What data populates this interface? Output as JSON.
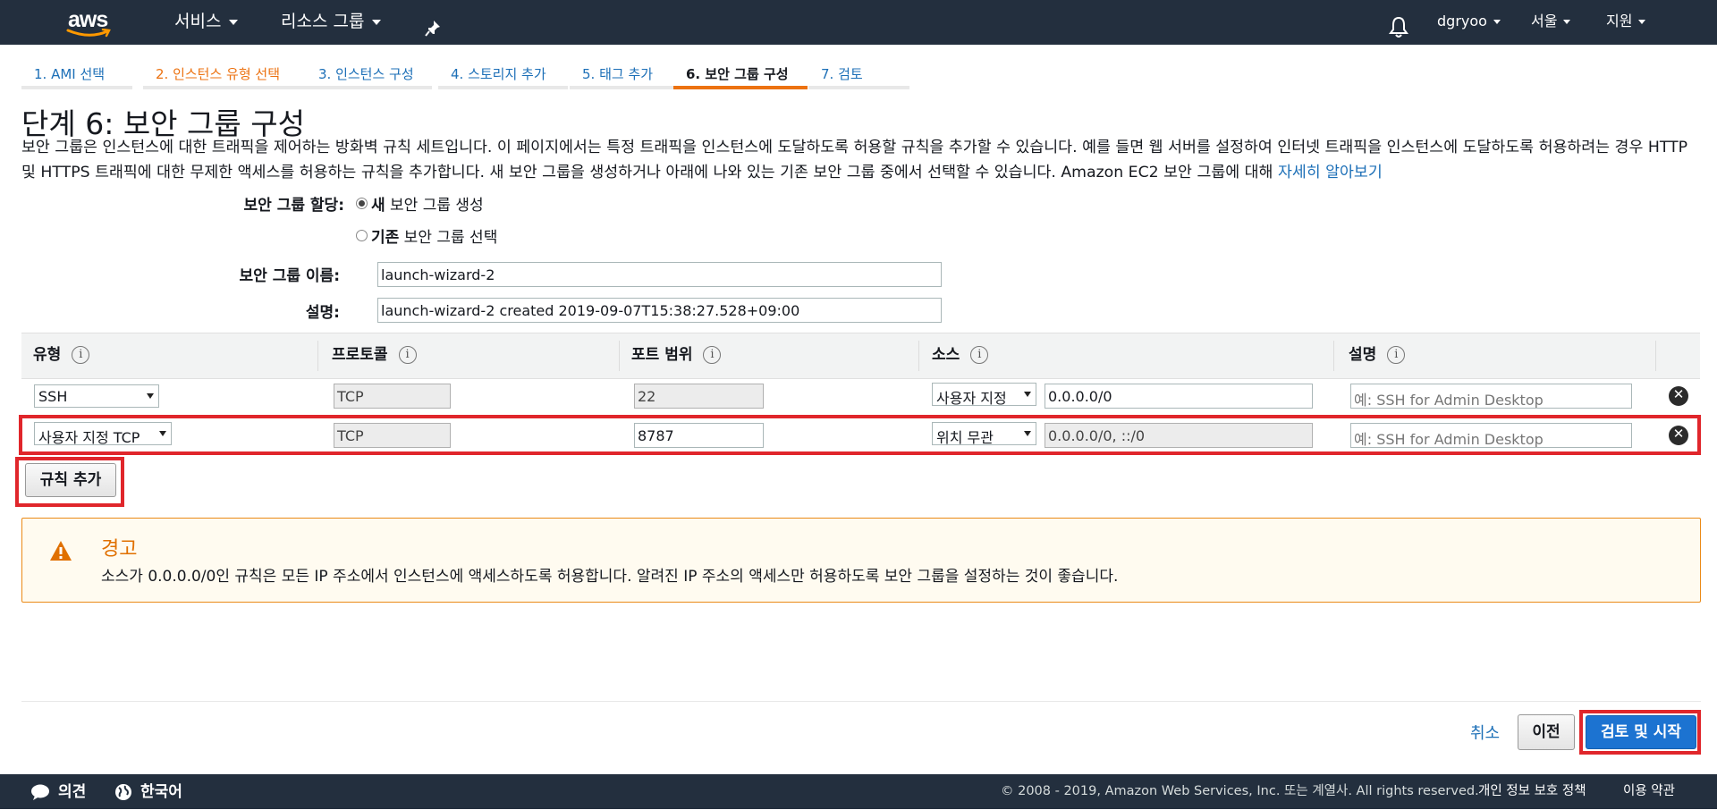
{
  "topnav": {
    "logo": "aws",
    "services": "서비스",
    "resource_groups": "리소스 그룹",
    "user": "dgryoo",
    "region": "서울",
    "support": "지원",
    "icons": [
      "pin-icon",
      "bell-icon"
    ]
  },
  "steps": [
    {
      "label": "1. AMI 선택"
    },
    {
      "label": "2. 인스턴스 유형 선택"
    },
    {
      "label": "3. 인스턴스 구성"
    },
    {
      "label": "4. 스토리지 추가"
    },
    {
      "label": "5. 태그 추가"
    },
    {
      "label": "6. 보안 그룹 구성"
    },
    {
      "label": "7. 검토"
    }
  ],
  "page": {
    "title": "단계 6: 보안 그룹 구성",
    "intro": "보안 그룹은 인스턴스에 대한 트래픽을 제어하는 방화벽 규칙 세트입니다. 이 페이지에서는 특정 트래픽을 인스턴스에 도달하도록 허용할 규칙을 추가할 수 있습니다. 예를 들면 웹 서버를 설정하여 인터넷 트래픽을 인스턴스에 도달하도록 허용하려는 경우 HTTP 및 HTTPS 트래픽에 대한 무제한 액세스를 허용하는 규칙을 추가합니다. 새 보안 그룹을 생성하거나 아래에 나와 있는 기존 보안 그룹 중에서 선택할 수 있습니다. Amazon EC2 보안 그룹에 대해 ",
    "learn_more": "자세히 알아보기"
  },
  "form": {
    "assign_label": "보안 그룹 할당:",
    "option_new_bold": "새",
    "option_new_rest": " 보안 그룹 생성",
    "option_existing_bold": "기존",
    "option_existing_rest": " 보안 그룹 선택",
    "selected_option": "new",
    "name_label": "보안 그룹 이름:",
    "name_value": "launch-wizard-2",
    "desc_label": "설명:",
    "desc_value": "launch-wizard-2 created 2019-09-07T15:38:27.528+09:00"
  },
  "table": {
    "headers": [
      "유형",
      "프로토콜",
      "포트 범위",
      "소스",
      "설명"
    ],
    "info_glyph": "i",
    "rows": [
      {
        "type": "SSH",
        "protocol": "TCP",
        "port": "22",
        "source_type": "사용자 지정",
        "source": "0.0.0.0/0",
        "description_placeholder": "예: SSH for Admin Desktop"
      },
      {
        "type": "사용자 지정 TCP",
        "protocol": "TCP",
        "port": "8787",
        "source_type": "위치 무관",
        "source": "0.0.0.0/0, ::/0",
        "description_placeholder": "예: SSH for Admin Desktop"
      }
    ]
  },
  "add_rule_label": "규칙 추가",
  "remove_glyph": "✕",
  "warning": {
    "title": "경고",
    "text": "소스가 0.0.0.0/0인 규칙은 모든 IP 주소에서 인스턴스에 액세스하도록 허용합니다. 알려진 IP 주소의 액세스만 허용하도록 보안 그룹을 설정하는 것이 좋습니다.",
    "icon": "warning-icon",
    "color": "#eb8a17"
  },
  "actions": {
    "cancel": "취소",
    "previous": "이전",
    "review_launch": "검토 및 시작"
  },
  "footer": {
    "feedback": "의견",
    "language": "한국어",
    "copyright": "© 2008 - 2019, Amazon Web Services, Inc. 또는 계열사. All rights reserved.",
    "privacy": "개인 정보 보호 정책",
    "terms": "이용 약관"
  },
  "colors": {
    "nav_bg": "#232f3e",
    "accent_orange": "#ec7211",
    "link_blue": "#1c6fb7",
    "primary_button": "#1c73d1",
    "highlight_red": "#e0262b"
  }
}
